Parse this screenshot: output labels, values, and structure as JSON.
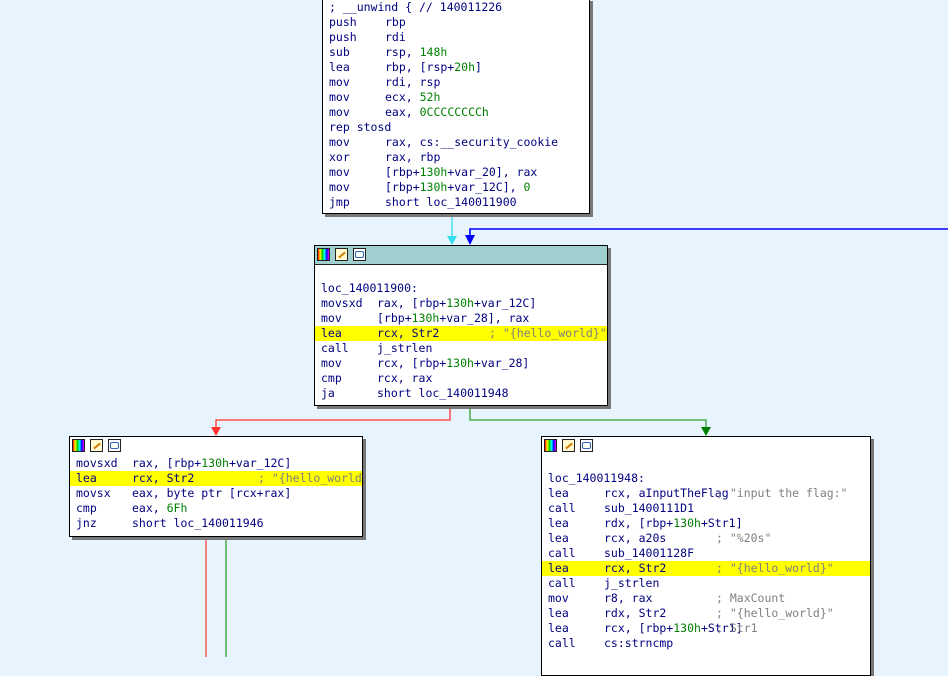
{
  "top_block": {
    "lines": [
      {
        "m": "; __unwind { // 140011226",
        "o": "",
        "c": ""
      },
      {
        "m": "push",
        "o": "rbp",
        "c": ""
      },
      {
        "m": "push",
        "o": "rdi",
        "c": ""
      },
      {
        "m": "sub",
        "o": "rsp, 148h",
        "c": ""
      },
      {
        "m": "lea",
        "o": "rbp, [rsp+20h]",
        "c": ""
      },
      {
        "m": "mov",
        "o": "rdi, rsp",
        "c": ""
      },
      {
        "m": "mov",
        "o": "ecx, 52h",
        "c": ""
      },
      {
        "m": "mov",
        "o": "eax, 0CCCCCCCCh",
        "c": ""
      },
      {
        "m": "rep stosd",
        "o": "",
        "c": ""
      },
      {
        "m": "mov",
        "o": "rax, cs:__security_cookie",
        "c": ""
      },
      {
        "m": "xor",
        "o": "rax, rbp",
        "c": ""
      },
      {
        "m": "mov",
        "o": "[rbp+130h+var_20], rax",
        "c": ""
      },
      {
        "m": "mov",
        "o": "[rbp+130h+var_12C], 0",
        "c": ""
      },
      {
        "m": "jmp",
        "o": "short loc_140011900",
        "c": ""
      }
    ]
  },
  "mid_block": {
    "label": "loc_140011900:",
    "lines": [
      {
        "m": "movsxd",
        "o": "rax, [rbp+130h+var_12C]",
        "c": ""
      },
      {
        "m": "mov",
        "o": "[rbp+130h+var_28], rax",
        "c": ""
      },
      {
        "m": "lea",
        "o": "rcx, Str2",
        "c": "; \"{hello_world}\"",
        "hl": true
      },
      {
        "m": "call",
        "o": "j_strlen",
        "c": ""
      },
      {
        "m": "mov",
        "o": "rcx, [rbp+130h+var_28]",
        "c": ""
      },
      {
        "m": "cmp",
        "o": "rcx, rax",
        "c": ""
      },
      {
        "m": "ja",
        "o": "short loc_140011948",
        "c": ""
      }
    ]
  },
  "left_block": {
    "lines": [
      {
        "m": "movsxd",
        "o": "rax, [rbp+130h+var_12C]",
        "c": ""
      },
      {
        "m": "lea",
        "o": "rcx, Str2",
        "c": "; \"{hello_world}\"",
        "hl": true
      },
      {
        "m": "movsx",
        "o": "eax, byte ptr [rcx+rax]",
        "c": ""
      },
      {
        "m": "cmp",
        "o": "eax, 6Fh",
        "c": ""
      },
      {
        "m": "jnz",
        "o": "short loc_140011946",
        "c": ""
      }
    ]
  },
  "right_block": {
    "label": "loc_140011948:",
    "lines": [
      {
        "m": "lea",
        "o": "rcx, aInputTheFlag",
        "c": "; \"input the flag:\""
      },
      {
        "m": "call",
        "o": "sub_1400111D1",
        "c": ""
      },
      {
        "m": "lea",
        "o": "rdx, [rbp+130h+Str1]",
        "c": ""
      },
      {
        "m": "lea",
        "o": "rcx, a20s",
        "c": "; \"%20s\""
      },
      {
        "m": "call",
        "o": "sub_14001128F",
        "c": ""
      },
      {
        "m": "lea",
        "o": "rcx, Str2",
        "c": "; \"{hello_world}\"",
        "hl": true
      },
      {
        "m": "call",
        "o": "j_strlen",
        "c": ""
      },
      {
        "m": "mov",
        "o": "r8, rax",
        "c": "; MaxCount"
      },
      {
        "m": "lea",
        "o": "rdx, Str2",
        "c": "; \"{hello_world}\""
      },
      {
        "m": "lea",
        "o": "rcx, [rbp+130h+Str1]",
        "c": "; Str1"
      },
      {
        "m": "call",
        "o": "cs:strncmp",
        "c": ""
      }
    ]
  },
  "colors": {
    "background": "#e7f4fd",
    "highlight": "#ffff00",
    "edge_true": "#008000",
    "edge_false": "#ff0000",
    "edge_loop": "#0000ff",
    "edge_flow": "#00e0ff"
  }
}
